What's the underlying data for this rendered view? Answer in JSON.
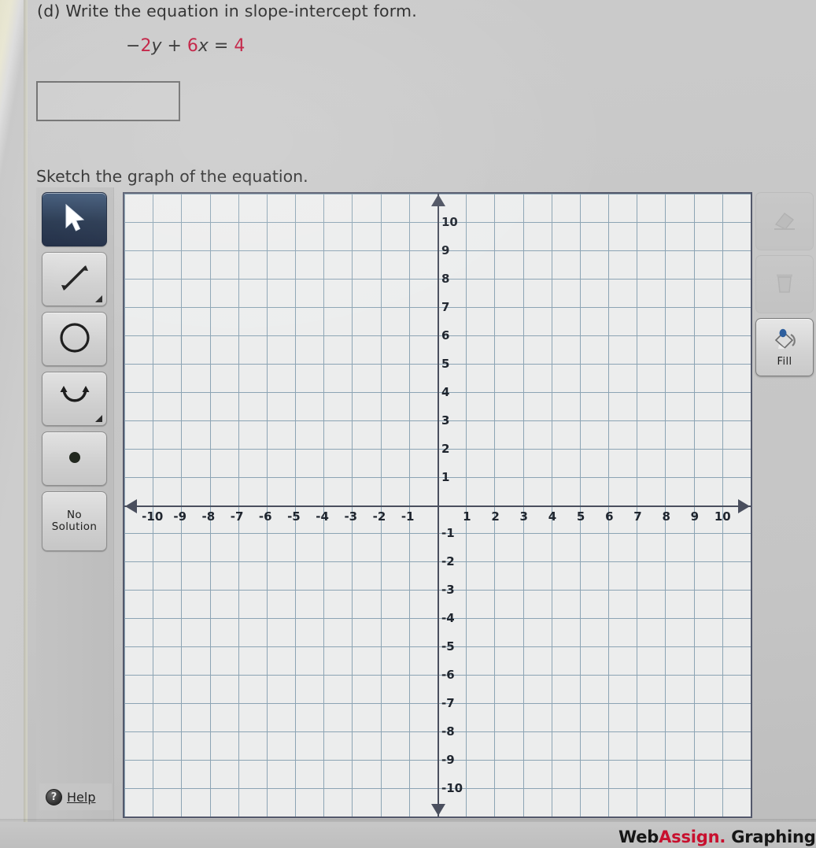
{
  "question": {
    "prompt": "(d) Write the equation in slope-intercept form.",
    "equation_parts": [
      {
        "t": "−",
        "k": "op"
      },
      {
        "t": "2",
        "k": "num"
      },
      {
        "t": "y",
        "k": "var"
      },
      {
        "t": " + ",
        "k": "op"
      },
      {
        "t": "6",
        "k": "num"
      },
      {
        "t": "x",
        "k": "var"
      },
      {
        "t": " = ",
        "k": "op"
      },
      {
        "t": "4",
        "k": "num"
      }
    ],
    "equation_text": "−2y + 6x = 4",
    "answer_value": "",
    "answer_placeholder": "",
    "sketch_instruction": "Sketch the graph of the equation."
  },
  "toolbar_left": {
    "items": [
      {
        "name": "select-tool",
        "icon": "cursor-arrow-icon",
        "label": "",
        "active": true,
        "has_submenu": false
      },
      {
        "name": "line-tool",
        "icon": "double-arrow-line-icon",
        "label": "",
        "active": false,
        "has_submenu": true
      },
      {
        "name": "circle-tool",
        "icon": "circle-icon",
        "label": "",
        "active": false,
        "has_submenu": false
      },
      {
        "name": "parabola-tool",
        "icon": "parabola-icon",
        "label": "",
        "active": false,
        "has_submenu": true
      },
      {
        "name": "point-tool",
        "icon": "filled-dot-icon",
        "label": "",
        "active": false,
        "has_submenu": false
      },
      {
        "name": "no-solution-tool",
        "icon": "",
        "label": "No\nSolution",
        "label_line1": "No",
        "label_line2": "Solution",
        "active": false,
        "has_submenu": false
      }
    ],
    "help_label": "Help",
    "help_icon": "question-mark-circle-icon"
  },
  "toolbar_right": {
    "items": [
      {
        "name": "eraser-button",
        "icon": "eraser-icon",
        "label": "",
        "disabled": true
      },
      {
        "name": "delete-button",
        "icon": "trash-can-icon",
        "label": "",
        "disabled": true
      },
      {
        "name": "fill-button",
        "icon": "paint-bucket-icon",
        "label": "Fill",
        "disabled": false
      }
    ]
  },
  "footer": {
    "brand_web": "Web",
    "brand_assign": "Assign.",
    "brand_rest": " Graphing To"
  },
  "chart_data": {
    "type": "scatter",
    "title": "",
    "xlabel": "",
    "ylabel": "",
    "xlim": [
      -11,
      11
    ],
    "ylim": [
      -11,
      11
    ],
    "grid": true,
    "grid_step": 1,
    "x_ticks": [
      -10,
      -9,
      -8,
      -7,
      -6,
      -5,
      -4,
      -3,
      -2,
      -1,
      1,
      2,
      3,
      4,
      5,
      6,
      7,
      8,
      9,
      10
    ],
    "y_ticks": [
      10,
      9,
      8,
      7,
      6,
      5,
      4,
      3,
      2,
      1,
      -1,
      -2,
      -3,
      -4,
      -5,
      -6,
      -7,
      -8,
      -9,
      -10
    ],
    "x_tick_labels": [
      "-10",
      "-9",
      "-8",
      "-7",
      "-6",
      "-5",
      "-4",
      "-3",
      "-2",
      "-1",
      "1",
      "2",
      "3",
      "4",
      "5",
      "6",
      "7",
      "8",
      "9",
      "10"
    ],
    "y_tick_labels": [
      "10",
      "9",
      "8",
      "7",
      "6",
      "5",
      "4",
      "3",
      "2",
      "1",
      "-1",
      "-2",
      "-3",
      "-4",
      "-5",
      "-6",
      "-7",
      "-8",
      "-9",
      "-10"
    ],
    "series": [],
    "annotations": [],
    "colors": {
      "grid": "#8ca4b4",
      "axis": "#4a4f5e",
      "background": "#eceded",
      "accent": "#c8102e"
    }
  }
}
